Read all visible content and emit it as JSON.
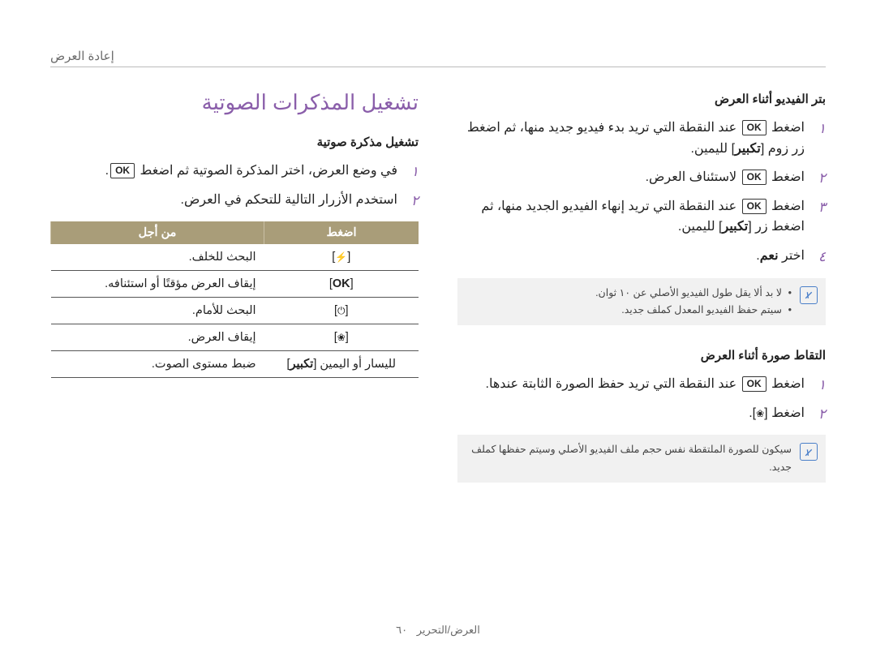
{
  "header": "إعادة العرض",
  "right": {
    "sec1": {
      "title": "بتر الفيديو أثناء العرض",
      "items": [
        "اضغط [OK] عند النقطة التي تريد بدء فيديو جديد منها، ثم اضغط زر زوم [تكبير] لليمين.",
        "اضغط [OK] لاستئناف العرض.",
        "اضغط [OK] عند النقطة التي تريد إنهاء الفيديو الجديد منها، ثم اضغط زر [تكبير] لليمين.",
        "اختر نعم."
      ],
      "note": [
        "لا بد ألا يقل طول الفيديو الأصلي عن ١٠ ثوان.",
        "سيتم حفظ الفيديو المعدل كملف جديد."
      ]
    },
    "sec2": {
      "title": "التقاط صورة أثناء العرض",
      "items": [
        "اضغط [OK] عند النقطة التي تريد حفظ الصورة الثابتة عندها.",
        "اضغط [❀]."
      ],
      "note": "سيكون للصورة الملتقطة نفس حجم ملف الفيديو الأصلي وسيتم حفظها كملف جديد."
    }
  },
  "left": {
    "bigtitle": "تشغيل المذكرات الصوتية",
    "subtitle": "تشغيل مذكرة صوتية",
    "items": [
      "في وضع العرض، اختر المذكرة الصوتية ثم اضغط [OK].",
      "استخدم الأزرار التالية للتحكم في العرض."
    ],
    "table": {
      "head": [
        "اضغط",
        "من أجل"
      ],
      "rows": [
        {
          "btn": "[⚡]",
          "label": "البحث للخلف."
        },
        {
          "btn": "[OK]",
          "label": "إيقاف العرض مؤقتًا أو استئنافه."
        },
        {
          "btn": "[⏻]",
          "label": "البحث للأمام."
        },
        {
          "btn": "[❀]",
          "label": "إيقاف العرض."
        },
        {
          "btn": "[تكبير] لليسار أو اليمين",
          "label": "ضبط مستوى الصوت."
        }
      ]
    }
  },
  "footer": {
    "section": "العرض/التحرير",
    "page": "٦٠"
  }
}
